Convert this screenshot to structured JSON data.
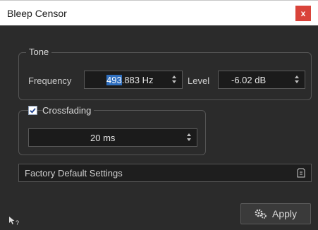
{
  "window": {
    "title": "Bleep Censor",
    "close_label": "x"
  },
  "tone": {
    "legend": "Tone",
    "frequency_label": "Frequency",
    "frequency_selected": "493",
    "frequency_rest": ".883 Hz",
    "level_label": "Level",
    "level_value": "-6.02 dB"
  },
  "crossfading": {
    "label": "Crossfading",
    "checked": true,
    "value": "20 ms"
  },
  "preset": {
    "label": "Factory Default Settings"
  },
  "apply": {
    "label": "Apply"
  },
  "colors": {
    "panel_bg": "#2b2b2b",
    "close_red": "#d9433a",
    "selection_blue": "#2f6fbf"
  },
  "icons": {
    "close": "close-icon",
    "spin": "spin-arrows-icon",
    "preset_menu": "preset-menu-icon",
    "apply": "gears-icon",
    "help": "help-pointer-icon",
    "check": "checkmark-icon"
  }
}
